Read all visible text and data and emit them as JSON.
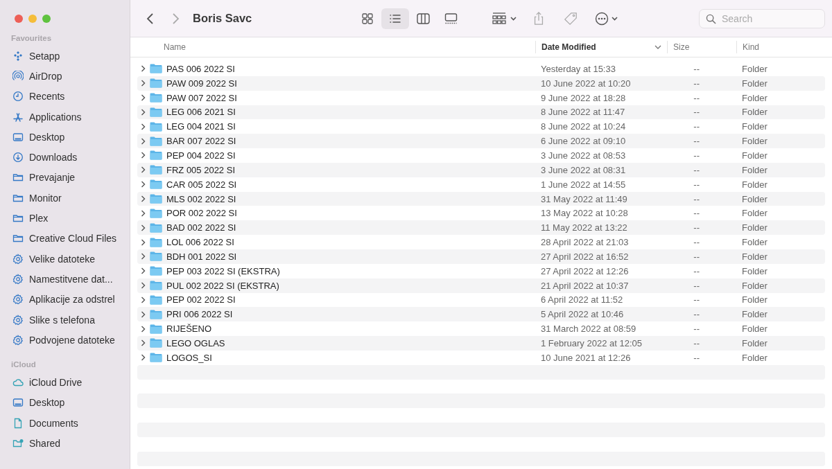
{
  "window": {
    "title": "Boris Savc"
  },
  "sidebar": {
    "sections": [
      {
        "heading": "Favourites",
        "items": [
          {
            "label": "Setapp",
            "kind": "setapp"
          },
          {
            "label": "AirDrop",
            "kind": "airdrop"
          },
          {
            "label": "Recents",
            "kind": "clock"
          },
          {
            "label": "Applications",
            "kind": "apps"
          },
          {
            "label": "Desktop",
            "kind": "desktop"
          },
          {
            "label": "Downloads",
            "kind": "download"
          },
          {
            "label": "Prevajanje",
            "kind": "folder"
          },
          {
            "label": "Monitor",
            "kind": "folder"
          },
          {
            "label": "Plex",
            "kind": "folder"
          },
          {
            "label": "Creative Cloud Files",
            "kind": "folder"
          },
          {
            "label": "Velike datoteke",
            "kind": "gear"
          },
          {
            "label": "Namestitvene dat...",
            "kind": "gear"
          },
          {
            "label": "Aplikacije za odstrel",
            "kind": "gear"
          },
          {
            "label": "Slike s telefona",
            "kind": "gear"
          },
          {
            "label": "Podvojene datoteke",
            "kind": "gear"
          }
        ]
      },
      {
        "heading": "iCloud",
        "items": [
          {
            "label": "iCloud Drive",
            "kind": "cloud"
          },
          {
            "label": "Desktop",
            "kind": "desktop"
          },
          {
            "label": "Documents",
            "kind": "document"
          },
          {
            "label": "Shared",
            "kind": "shared"
          }
        ]
      }
    ]
  },
  "toolbar": {
    "views": [
      {
        "kind": "icons",
        "selected": false
      },
      {
        "kind": "list",
        "selected": true
      },
      {
        "kind": "columns",
        "selected": false
      },
      {
        "kind": "gallery",
        "selected": false
      }
    ],
    "search": {
      "placeholder": "Search"
    }
  },
  "table": {
    "columns": [
      {
        "label": "Name",
        "sorted": false
      },
      {
        "label": "Date Modified",
        "sorted": true
      },
      {
        "label": "Size",
        "sorted": false
      },
      {
        "label": "Kind",
        "sorted": false
      }
    ],
    "rows": [
      {
        "name": "PAS 006 2022 SI",
        "date": "Yesterday at 15:33",
        "size": "--",
        "kind": "Folder"
      },
      {
        "name": "PAW 009 2022 SI",
        "date": "10 June 2022 at 10:20",
        "size": "--",
        "kind": "Folder"
      },
      {
        "name": "PAW 007 2022 SI",
        "date": "9 June 2022 at 18:28",
        "size": "--",
        "kind": "Folder"
      },
      {
        "name": "LEG 006 2021 SI",
        "date": "8 June 2022 at 11:47",
        "size": "--",
        "kind": "Folder"
      },
      {
        "name": "LEG 004 2021 SI",
        "date": "8 June 2022 at 10:24",
        "size": "--",
        "kind": "Folder"
      },
      {
        "name": "BAR 007 2022 SI",
        "date": "6 June 2022 at 09:10",
        "size": "--",
        "kind": "Folder"
      },
      {
        "name": "PEP 004 2022 SI",
        "date": "3 June 2022 at 08:53",
        "size": "--",
        "kind": "Folder"
      },
      {
        "name": "FRZ 005 2022 SI",
        "date": "3 June 2022 at 08:31",
        "size": "--",
        "kind": "Folder"
      },
      {
        "name": "CAR 005 2022 SI",
        "date": "1 June 2022 at 14:55",
        "size": "--",
        "kind": "Folder"
      },
      {
        "name": "MLS 002 2022 SI",
        "date": "31 May 2022 at 11:49",
        "size": "--",
        "kind": "Folder"
      },
      {
        "name": "POR 002 2022 SI",
        "date": "13 May 2022 at 10:28",
        "size": "--",
        "kind": "Folder"
      },
      {
        "name": "BAD 002 2022 SI",
        "date": "11 May 2022 at 13:22",
        "size": "--",
        "kind": "Folder"
      },
      {
        "name": "LOL 006 2022 SI",
        "date": "28 April 2022 at 21:03",
        "size": "--",
        "kind": "Folder"
      },
      {
        "name": "BDH 001 2022 SI",
        "date": "27 April 2022 at 16:52",
        "size": "--",
        "kind": "Folder"
      },
      {
        "name": "PEP 003 2022 SI (EKSTRA)",
        "date": "27 April 2022 at 12:26",
        "size": "--",
        "kind": "Folder"
      },
      {
        "name": "PUL 002 2022 SI (EKSTRA)",
        "date": "21 April 2022 at 10:37",
        "size": "--",
        "kind": "Folder"
      },
      {
        "name": "PEP 002 2022 SI",
        "date": "6 April 2022 at 11:52",
        "size": "--",
        "kind": "Folder"
      },
      {
        "name": "PRI 006 2022 SI",
        "date": "5 April 2022 at 10:46",
        "size": "--",
        "kind": "Folder"
      },
      {
        "name": "RIJEŠENO",
        "date": "31 March 2022 at 08:59",
        "size": "--",
        "kind": "Folder"
      },
      {
        "name": "LEGO OGLAS",
        "date": "1 February 2022 at 12:05",
        "size": "--",
        "kind": "Folder"
      },
      {
        "name": "LOGOS_SI",
        "date": "10 June 2021 at 12:26",
        "size": "--",
        "kind": "Folder"
      }
    ]
  }
}
